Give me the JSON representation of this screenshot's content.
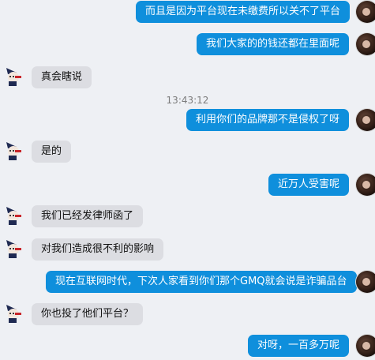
{
  "messages": [
    {
      "from": "self",
      "text": "而且是因为平台现在未缴费所以关不了平台"
    },
    {
      "from": "self",
      "text": "我们大家的的钱还都在里面呢"
    },
    {
      "from": "bot",
      "text": "真会瞎说"
    },
    {
      "from": "self",
      "text": "利用你们的品牌那不是侵权了呀"
    },
    {
      "from": "bot",
      "text": "是的"
    },
    {
      "from": "self",
      "text": "近万人受害呢"
    },
    {
      "from": "bot",
      "text": "我们已经发律师函了"
    },
    {
      "from": "bot",
      "text": "对我们造成很不利的影响"
    },
    {
      "from": "self",
      "text": "现在互联网时代，下次人家看到你们那个GMQ就会说是诈骗品台"
    },
    {
      "from": "bot",
      "text": "你也投了他们平台？"
    },
    {
      "from": "self",
      "text": "对呀，一百多万呢"
    }
  ],
  "timestamp": "13:43:12",
  "colors": {
    "self_bubble": "#0f8fdc",
    "bot_bubble": "#dcdde2",
    "background": "#eef0f4"
  }
}
